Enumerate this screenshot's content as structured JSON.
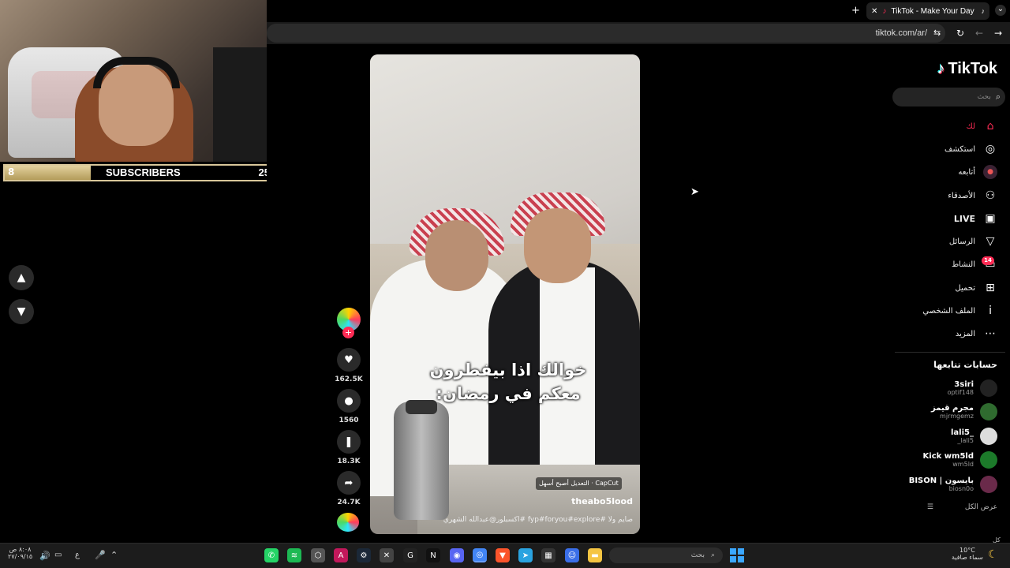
{
  "overlay": {
    "subscribers_current": "8",
    "subscribers_label": "SUBSCRIBERS",
    "subscribers_goal": "25",
    "progress_fraction": 0.32
  },
  "browser": {
    "tab_title": "TikTok - Make Your Day",
    "url": "tiktok.com/ar/"
  },
  "video": {
    "caption_line1": "خوالك اذا بيفطرون",
    "caption_line2": "معكم في رمضان:",
    "capcut": "CapCut · التعديل أصبح أسهل",
    "author": "theabo5lood",
    "description": "صايم ولا  #fyp#foryou#explore  #اكسبلور@عبدالله الشهري"
  },
  "actions": {
    "likes": "162.5K",
    "comments": "1560",
    "saves": "18.3K",
    "shares": "24.7K"
  },
  "sidebar": {
    "logo": "TikTok",
    "search_placeholder": "بحث",
    "menu": [
      {
        "label": "لك",
        "icon": "home-icon",
        "glyph": "⌂"
      },
      {
        "label": "استكشف",
        "icon": "compass-icon",
        "glyph": "◎"
      },
      {
        "label": "أتابعه",
        "icon": "following-avatar-icon",
        "glyph": "●"
      },
      {
        "label": "الأصدقاء",
        "icon": "friends-icon",
        "glyph": "⚇"
      },
      {
        "label": "LIVE",
        "icon": "live-icon",
        "glyph": "▣"
      },
      {
        "label": "الرسائل",
        "icon": "messages-icon",
        "glyph": "▽"
      },
      {
        "label": "النشاط",
        "icon": "activity-icon",
        "glyph": "▭"
      },
      {
        "label": "تحميل",
        "icon": "upload-icon",
        "glyph": "⊞"
      },
      {
        "label": "الملف الشخصي",
        "icon": "profile-icon",
        "glyph": "ⅰ"
      },
      {
        "label": "المزيد",
        "icon": "more-icon",
        "glyph": "⋯"
      }
    ],
    "activity_badge": "14",
    "following_title": "حسابات تتابعها",
    "accounts": [
      {
        "name": "3siri",
        "handle": "optif148"
      },
      {
        "name": "مجرم قيمز",
        "handle": "mjrmgemz"
      },
      {
        "name": "lali5_",
        "handle": "_lali5"
      },
      {
        "name": "Kick wm5ld",
        "handle": "wm5ld"
      },
      {
        "name": "BISON | بايسون",
        "handle": "biosn0o"
      }
    ],
    "see_all": "عرض الكل",
    "bottom_text": "كل كل"
  },
  "taskbar": {
    "time": "٨:٠٨ ص",
    "date": "٢٧/٠٩/١٥",
    "lang": "ع",
    "search_placeholder": "بحث",
    "weather_temp": "10°C",
    "weather_desc": "سماء صافية"
  },
  "colors": {
    "accent": "#fe2c55",
    "overlay_gold": "#d9c79a"
  }
}
